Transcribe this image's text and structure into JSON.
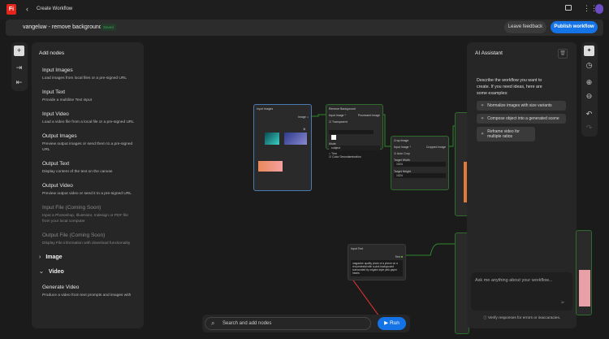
{
  "header": {
    "back_label": "Create Workflow",
    "logo_text": "Fi"
  },
  "workflow": {
    "name": "vangeluw - remove background",
    "status": "Saved",
    "feedback": "Leave feedback",
    "publish": "Publish workflow"
  },
  "add_nodes": {
    "title": "Add nodes",
    "items": [
      {
        "title": "Input Images",
        "desc": "Load images from local files or a pre-signed URL"
      },
      {
        "title": "Input Text",
        "desc": "Provide a multiline Text input"
      },
      {
        "title": "Input Video",
        "desc": "Load a video file from a local file or a pre-signed URL"
      },
      {
        "title": "Output Images",
        "desc": "Preview output images or send them to a pre-signed URL"
      },
      {
        "title": "Output Text",
        "desc": "Display content of the text on the canvas"
      },
      {
        "title": "Output Video",
        "desc": "Preview output video or send it to a pre-signed URL"
      },
      {
        "title": "Input File (Coming Soon)",
        "desc": "Input a Photoshop, Illustrator, Indesign or PDF file from your local computer"
      },
      {
        "title": "Output File (Coming Soon)",
        "desc": "Display File information with download functionality"
      }
    ],
    "sections": [
      "Image",
      "Video"
    ],
    "video_item": {
      "title": "Generate Video",
      "desc": "Produce a video from text prompts and images with"
    }
  },
  "nodes": {
    "input_images": {
      "title": "Input Images",
      "port": "Image"
    },
    "remove_bg": {
      "title": "Remove Background",
      "in": "Input Image *",
      "out": "Processed Image",
      "transparent": "Transparent",
      "mode": "Mode",
      "mode_value": "subject",
      "trim": "Trim",
      "decon": "Color Decontamination"
    },
    "crop": {
      "title": "Crop Image",
      "in": "Input Image *",
      "out": "Cropped Image",
      "auto": "Auto Crop",
      "tw": "Target Width",
      "tw_value": "1024",
      "th": "Target Height",
      "th_value": "1024"
    },
    "input_text": {
      "title": "Input Text",
      "port": "Text",
      "value": "magazine quality photo of a phone on a red pedestal with a pink background surrounded by origami style pink paper hearts"
    }
  },
  "bottom": {
    "search_placeholder": "Search and add nodes",
    "run": "Run"
  },
  "ai": {
    "title": "AI Assistant",
    "intro": "Describe the workflow you want to create. If you need ideas, here are some examples:",
    "examples": [
      "Normalize images with size variants",
      "Compose object into a generated scene",
      "Reframe video for multiple ratios"
    ],
    "placeholder": "Ask me anything about your workflow...",
    "disclaimer": "Verify responses for errors or inaccuracies."
  }
}
